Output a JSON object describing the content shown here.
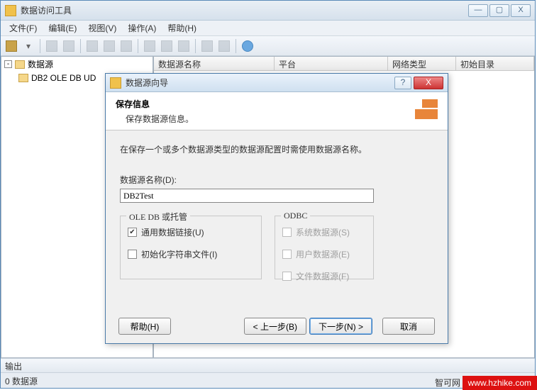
{
  "main_window": {
    "title": "数据访问工具",
    "menu": {
      "file": "文件(F)",
      "edit": "编辑(E)",
      "view": "视图(V)",
      "action": "操作(A)",
      "help": "帮助(H)"
    },
    "tree": {
      "root": "数据源",
      "item1": "DB2 OLE DB UD"
    },
    "grid": {
      "col_name": "数据源名称",
      "col_platform": "平台",
      "col_nettype": "网络类型",
      "col_initcat": "初始目录"
    },
    "output_label": "输出",
    "status": "0 数据源"
  },
  "wizard": {
    "title": "数据源向导",
    "header_title": "保存信息",
    "header_sub": "保存数据源信息。",
    "note": "在保存一个或多个数据源类型的数据源配置时需使用数据源名称。",
    "name_label": "数据源名称(D):",
    "name_value": "DB2Test",
    "group_oledb": "OLE DB 或托管",
    "chk_udl": "通用数据链接(U)",
    "chk_init": "初始化字符串文件(I)",
    "group_odbc": "ODBC",
    "chk_sys": "系统数据源(S)",
    "chk_user": "用户数据源(E)",
    "chk_file": "文件数据源(F)",
    "btn_help": "帮助(H)",
    "btn_back": "< 上一步(B)",
    "btn_next": "下一步(N) >",
    "btn_cancel": "取消"
  },
  "watermark": {
    "brand": "智可网",
    "url": "www.hzhike.com"
  }
}
